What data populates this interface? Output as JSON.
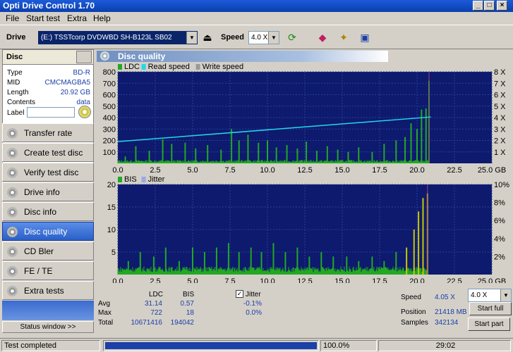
{
  "window": {
    "title": "Opti Drive Control 1.70",
    "minimize": "_",
    "maximize": "□",
    "close": "×"
  },
  "menu": [
    "File",
    "Start test",
    "Extra",
    "Help"
  ],
  "toolbar": {
    "drive_label": "Drive",
    "drive_value": "(E:)   TSSTcorp DVDWBD SH-B123L SB02",
    "speed_label": "Speed",
    "speed_value": "4.0 X"
  },
  "disc": {
    "header": "Disc",
    "rows": [
      {
        "key": "Type",
        "value": "BD-R"
      },
      {
        "key": "MID",
        "value": "CMCMAGBA5"
      },
      {
        "key": "Length",
        "value": "20.92 GB"
      },
      {
        "key": "Contents",
        "value": "data"
      }
    ],
    "label_key": "Label"
  },
  "nav": [
    {
      "label": "Transfer rate",
      "active": false
    },
    {
      "label": "Create test disc",
      "active": false
    },
    {
      "label": "Verify test disc",
      "active": false
    },
    {
      "label": "Drive info",
      "active": false
    },
    {
      "label": "Disc info",
      "active": false
    },
    {
      "label": "Disc quality",
      "active": true
    },
    {
      "label": "CD Bler",
      "active": false
    },
    {
      "label": "FE / TE",
      "active": false
    },
    {
      "label": "Extra tests",
      "active": false
    }
  ],
  "status_window_btn": "Status window >>",
  "panel_title": "Disc quality",
  "colors": {
    "ldc": "#22a822",
    "read": "#22d8e8",
    "write": "#9a9a9a",
    "bis": "#22a822",
    "jitter": "#9aa8e8",
    "plot_bg": "#0d1a6e",
    "spike": "#c8c800"
  },
  "chart_data": [
    {
      "type": "bar",
      "legend": [
        "LDC",
        "Read speed",
        "Write speed"
      ],
      "x_ticks": [
        "0.0",
        "2.5",
        "5.0",
        "7.5",
        "10.0",
        "12.5",
        "15.0",
        "17.5",
        "20.0",
        "22.5",
        "25.0 GB"
      ],
      "y_ticks": [
        "100",
        "200",
        "300",
        "400",
        "500",
        "600",
        "700",
        "800"
      ],
      "y2_ticks": [
        "1 X",
        "2 X",
        "3 X",
        "4 X",
        "5 X",
        "6 X",
        "7 X",
        "8 X"
      ],
      "xlim": [
        0,
        25
      ],
      "ylim": [
        0,
        800
      ],
      "y2lim": [
        0,
        8
      ],
      "read_speed": {
        "x": [
          0,
          20.92
        ],
        "y": [
          1.9,
          4.05
        ]
      },
      "ldc_peaks": [
        [
          0.5,
          60
        ],
        [
          1.2,
          150
        ],
        [
          2.1,
          110
        ],
        [
          3.0,
          210
        ],
        [
          3.6,
          170
        ],
        [
          4.5,
          180
        ],
        [
          5.2,
          130
        ],
        [
          6.0,
          160
        ],
        [
          6.9,
          120
        ],
        [
          7.6,
          300
        ],
        [
          8.1,
          200
        ],
        [
          8.7,
          250
        ],
        [
          9.4,
          180
        ],
        [
          10.0,
          200
        ],
        [
          10.6,
          140
        ],
        [
          11.3,
          160
        ],
        [
          12.0,
          130
        ],
        [
          12.6,
          190
        ],
        [
          13.3,
          110
        ],
        [
          14.0,
          150
        ],
        [
          14.7,
          120
        ],
        [
          15.4,
          100
        ],
        [
          16.1,
          140
        ],
        [
          17.0,
          100
        ],
        [
          17.8,
          170
        ],
        [
          18.6,
          200
        ],
        [
          19.2,
          230
        ],
        [
          19.6,
          350
        ],
        [
          20.0,
          300
        ],
        [
          20.3,
          470
        ],
        [
          20.6,
          480
        ],
        [
          20.8,
          722
        ]
      ]
    },
    {
      "type": "bar",
      "legend": [
        "BIS",
        "Jitter"
      ],
      "x_ticks": [
        "0.0",
        "2.5",
        "5.0",
        "7.5",
        "10.0",
        "12.5",
        "15.0",
        "17.5",
        "20.0",
        "22.5",
        "25.0 GB"
      ],
      "y_ticks": [
        "5",
        "10",
        "15",
        "20"
      ],
      "y2_ticks": [
        "2%",
        "4%",
        "6%",
        "8%",
        "10%"
      ],
      "xlim": [
        0,
        25
      ],
      "ylim": [
        0,
        20
      ],
      "y2lim": [
        0,
        10
      ],
      "bis_peaks": [
        [
          0.7,
          3
        ],
        [
          1.5,
          5
        ],
        [
          2.4,
          4
        ],
        [
          3.2,
          6
        ],
        [
          4.1,
          3
        ],
        [
          5.0,
          6
        ],
        [
          5.8,
          5
        ],
        [
          6.6,
          6
        ],
        [
          7.4,
          7
        ],
        [
          8.1,
          5
        ],
        [
          8.9,
          6
        ],
        [
          9.6,
          5
        ],
        [
          10.4,
          7
        ],
        [
          11.2,
          5
        ],
        [
          12.0,
          6
        ],
        [
          12.8,
          4
        ],
        [
          13.6,
          5
        ],
        [
          14.4,
          4
        ],
        [
          15.3,
          4
        ],
        [
          16.1,
          3
        ],
        [
          17.0,
          4
        ],
        [
          17.8,
          3
        ],
        [
          18.6,
          5
        ],
        [
          19.3,
          6
        ],
        [
          19.8,
          10
        ],
        [
          20.1,
          14
        ],
        [
          20.4,
          17
        ],
        [
          20.7,
          18
        ]
      ]
    }
  ],
  "stats": {
    "col_ldc": "LDC",
    "col_bis": "BIS",
    "jitter_label": "Jitter",
    "jitter_checked": "✓",
    "rows": [
      {
        "label": "Avg",
        "ldc": "31.14",
        "bis": "0.57",
        "jitter": "-0.1%"
      },
      {
        "label": "Max",
        "ldc": "722",
        "bis": "18",
        "jitter": "0.0%"
      },
      {
        "label": "Total",
        "ldc": "10671416",
        "bis": "194042",
        "jitter": ""
      }
    ]
  },
  "right_stats": {
    "speed_label": "Speed",
    "speed_value": "4.05 X",
    "speed_select": "4.0 X",
    "position_label": "Position",
    "position_value": "21418 MB",
    "samples_label": "Samples",
    "samples_value": "342134",
    "start_full": "Start full",
    "start_part": "Start part"
  },
  "statusbar": {
    "status": "Test completed",
    "percent": "100.0%",
    "progress": 1.0,
    "time": "29:02"
  }
}
